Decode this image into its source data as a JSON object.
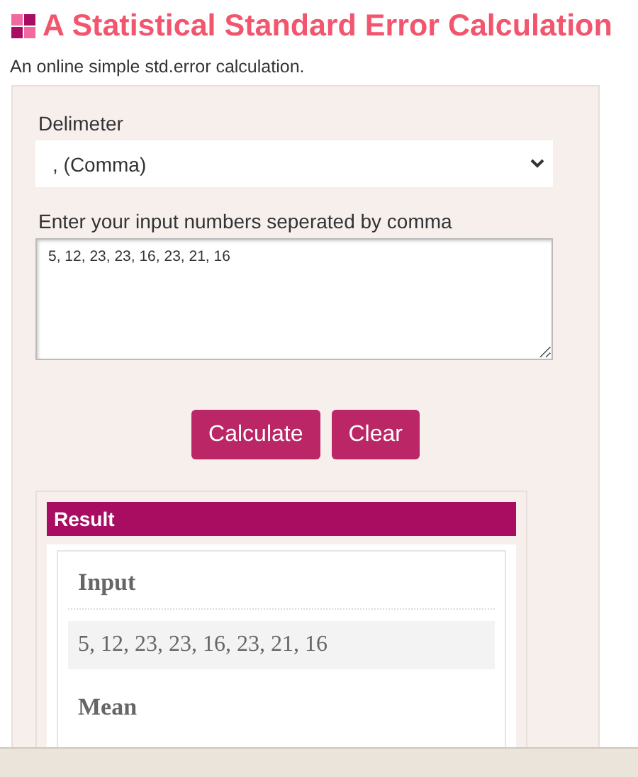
{
  "title": "A Statistical Standard Error Calculation",
  "subtitle": "An online simple std.error calculation.",
  "form": {
    "delimiter_label": "Delimeter",
    "delimiter_value": ", (Comma)",
    "input_label": "Enter your input numbers seperated by comma",
    "input_value": "5, 12, 23, 23, 16, 23, 21, 16"
  },
  "buttons": [
    "Calculate",
    "Clear"
  ],
  "result": {
    "header": "Result",
    "sections": [
      {
        "heading": "Input",
        "value": "5, 12, 23, 23, 16, 23, 21, 16"
      },
      {
        "heading": "Mean"
      }
    ]
  }
}
